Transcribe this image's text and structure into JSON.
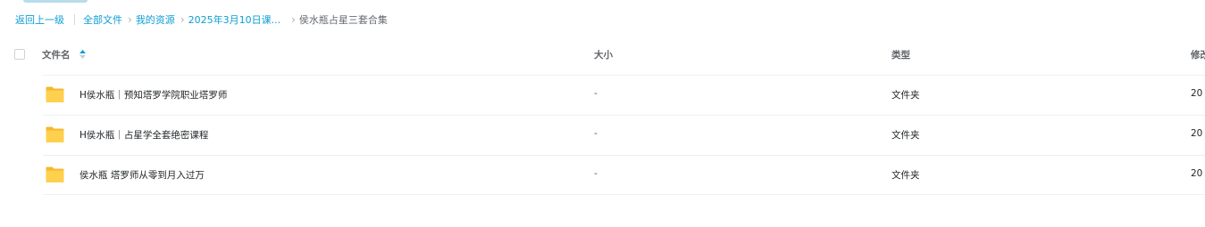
{
  "breadcrumb": {
    "back": "返回上一级",
    "items": [
      "全部文件",
      "我的资源",
      "2025年3月10日课..."
    ],
    "current": "侯水瓶占星三套合集"
  },
  "table": {
    "columns": {
      "name": "文件名",
      "size": "大小",
      "type": "类型",
      "modified": "修改"
    },
    "sort": "ascending",
    "rows": [
      {
        "name": "H侯水瓶｜预知塔罗学院职业塔罗师",
        "size": "-",
        "type": "文件夹",
        "modified": "20",
        "icon": "folder-icon"
      },
      {
        "name": "H侯水瓶｜占星学全套绝密课程",
        "size": "-",
        "type": "文件夹",
        "modified": "20",
        "icon": "folder-icon"
      },
      {
        "name": "侯水瓶 塔罗师从零到月入过万",
        "size": "-",
        "type": "文件夹",
        "modified": "20",
        "icon": "folder-icon"
      }
    ]
  },
  "colors": {
    "link": "#0c9dd3",
    "folder": "#ffc93a"
  }
}
